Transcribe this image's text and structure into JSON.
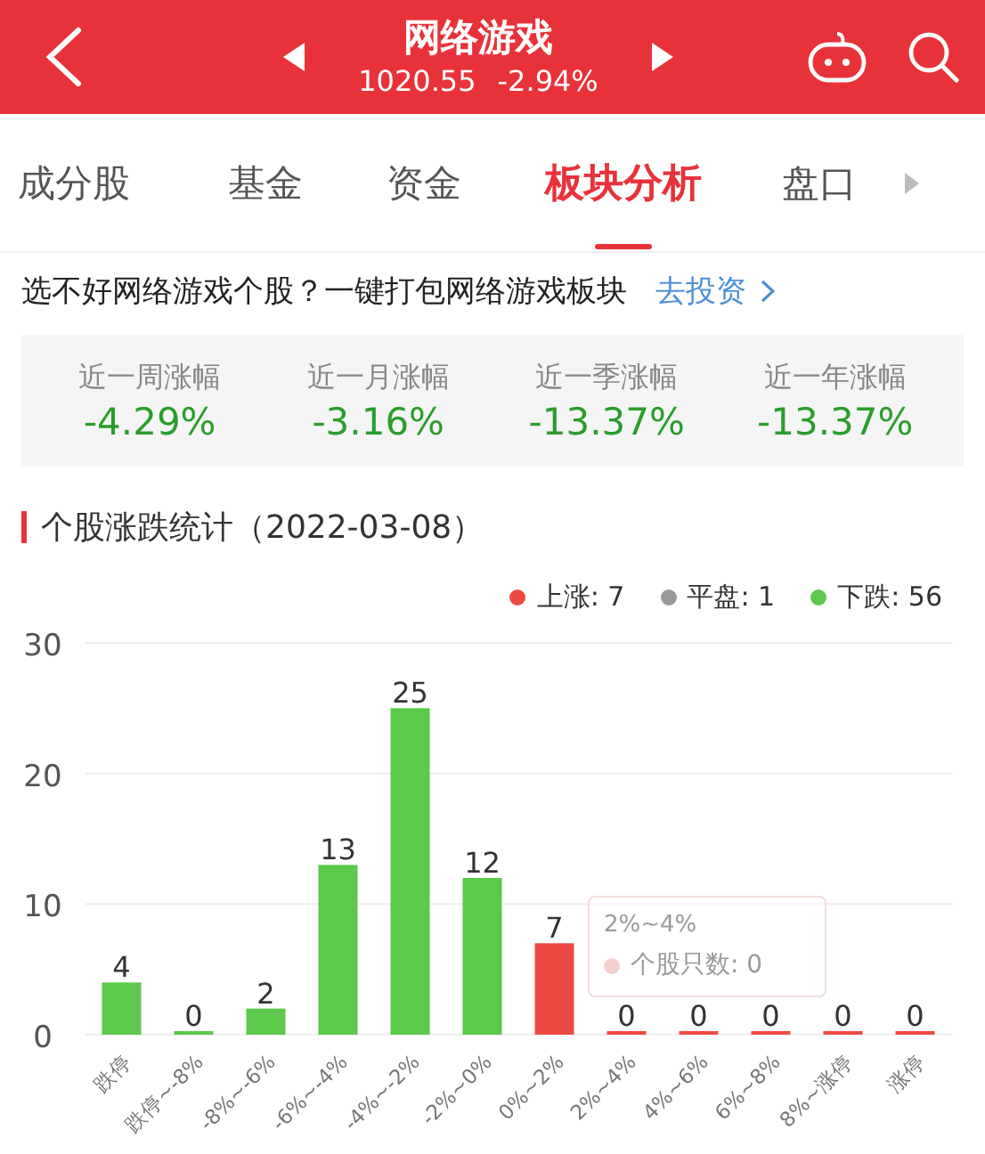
{
  "header": {
    "title": "网络游戏",
    "price": "1020.55",
    "change": "-2.94%"
  },
  "tabs": [
    {
      "label": "成分股",
      "selected": false
    },
    {
      "label": "基金",
      "selected": false
    },
    {
      "label": "资金",
      "selected": false
    },
    {
      "label": "板块分析",
      "selected": true
    },
    {
      "label": "盘口",
      "selected": false
    }
  ],
  "promo": {
    "text": "选不好网络游戏个股？一键打包网络游戏板块",
    "link": "去投资"
  },
  "stats": [
    {
      "label": "近一周涨幅",
      "value": "-4.29%"
    },
    {
      "label": "近一月涨幅",
      "value": "-3.16%"
    },
    {
      "label": "近一季涨幅",
      "value": "-13.37%"
    },
    {
      "label": "近一年涨幅",
      "value": "-13.37%"
    }
  ],
  "section": {
    "title": "个股涨跌统计（2022-03-08）"
  },
  "legend": [
    {
      "label": "上涨: 7",
      "color": "#ee4a44"
    },
    {
      "label": "平盘: 1",
      "color": "#999999"
    },
    {
      "label": "下跌: 56",
      "color": "#5cc84c"
    }
  ],
  "chart_data": {
    "type": "bar",
    "stacked": true,
    "data_labels": true,
    "ylim": [
      0,
      30
    ],
    "yticks": [
      0,
      10,
      20,
      30
    ],
    "categories": [
      "跌停",
      "跌停~-8%",
      "-8%~-6%",
      "-6%~-4%",
      "-4%~-2%",
      "-2%~0%",
      "0%~2%",
      "2%~4%",
      "4%~6%",
      "6%~8%",
      "8%~涨停",
      "涨停"
    ],
    "series": [
      {
        "color": "#5cc84c",
        "values": [
          4,
          0,
          2,
          13,
          25,
          12,
          null,
          null,
          null,
          null,
          null,
          null
        ]
      },
      {
        "color": "#ee4a44",
        "values": [
          null,
          null,
          null,
          null,
          null,
          null,
          7,
          0,
          0,
          0,
          0,
          0
        ]
      }
    ]
  },
  "tooltip": {
    "title": "2%~4%",
    "text": "个股只数: 0"
  }
}
